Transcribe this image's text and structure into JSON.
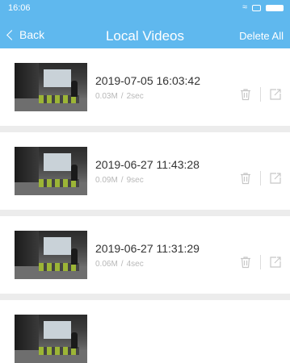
{
  "status": {
    "time": "16:06"
  },
  "nav": {
    "back_label": "Back",
    "title": "Local Videos",
    "delete_all_label": "Delete All"
  },
  "items": [
    {
      "datetime": "2019-07-05 16:03:42",
      "size": "0.03M",
      "duration": "2sec"
    },
    {
      "datetime": "2019-06-27 11:43:28",
      "size": "0.09M",
      "duration": "9sec"
    },
    {
      "datetime": "2019-06-27 11:31:29",
      "size": "0.06M",
      "duration": "4sec"
    }
  ],
  "colors": {
    "header": "#5fb8ee",
    "meta": "#b8b8b8",
    "separator": "#ececec"
  },
  "icons": {
    "trash": "trash-icon",
    "share": "share-icon",
    "back": "chevron-left-icon"
  }
}
